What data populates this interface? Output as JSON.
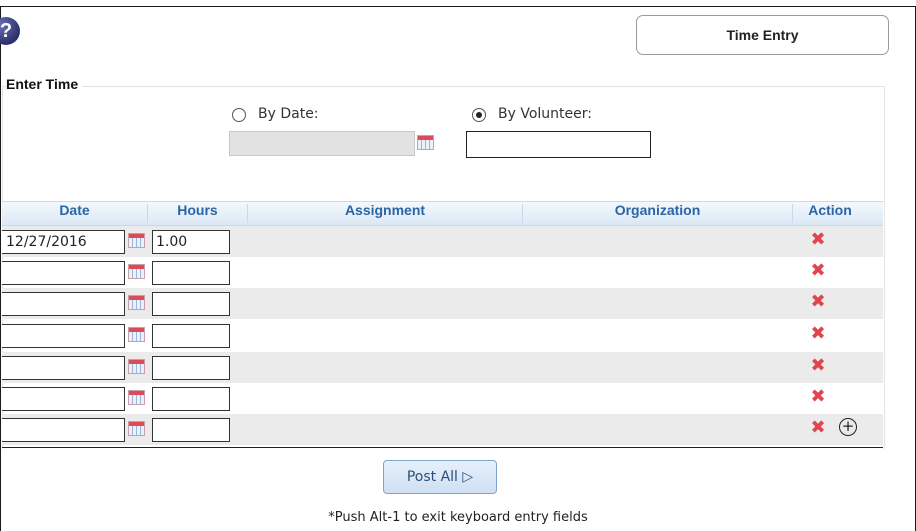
{
  "header": {
    "help_icon_glyph": "?",
    "tab_label": "Time Entry"
  },
  "enter_time": {
    "legend": "Enter Time",
    "by_date_label": "By Date:",
    "by_volunteer_label": "By Volunteer:",
    "selected_mode": "By Volunteer",
    "date_value": "",
    "volunteer_value": ""
  },
  "table": {
    "columns": [
      "Date",
      "Hours",
      "Assignment",
      "Organization",
      "Action"
    ],
    "rows": [
      {
        "date": "12/27/2016",
        "hours": "1.00"
      },
      {
        "date": "",
        "hours": ""
      },
      {
        "date": "",
        "hours": ""
      },
      {
        "date": "",
        "hours": ""
      },
      {
        "date": "",
        "hours": ""
      },
      {
        "date": "",
        "hours": ""
      },
      {
        "date": "",
        "hours": ""
      }
    ],
    "delete_icon": "red-x-icon",
    "add_icon": "plus-circle-icon"
  },
  "footer": {
    "post_all_label": "Post All ▷",
    "note": "*Push Alt-1 to exit keyboard entry fields"
  },
  "colors": {
    "header_text": "#2a65a6",
    "delete_red": "#e0454f",
    "shaded_row": "#ebebeb"
  }
}
